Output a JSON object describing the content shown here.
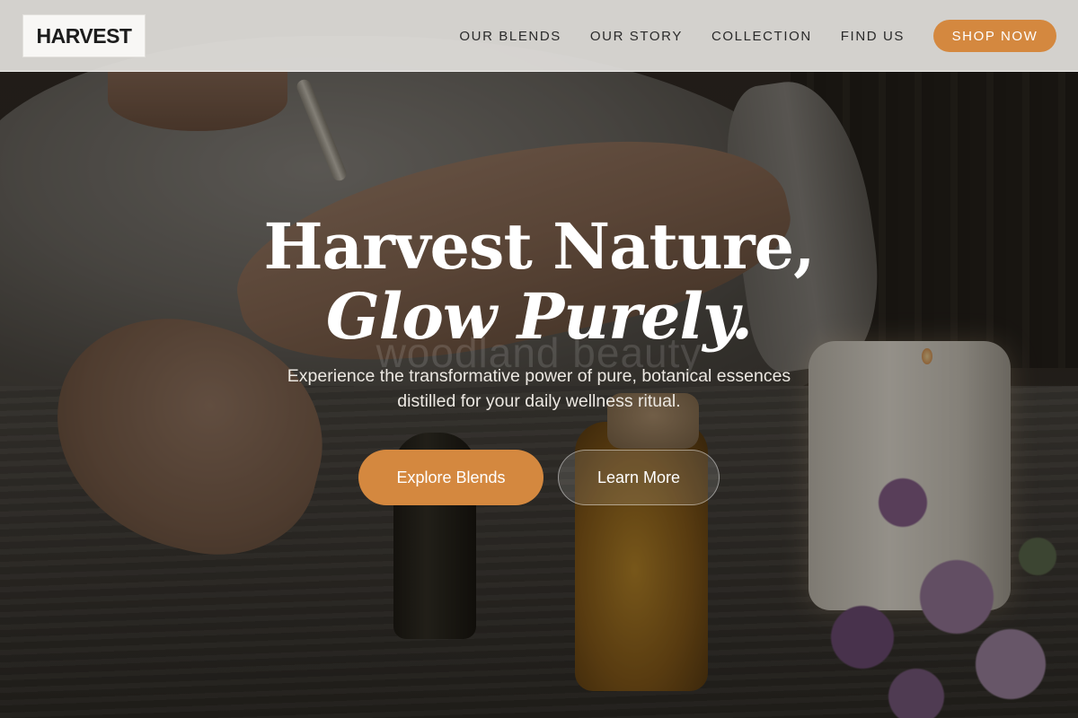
{
  "brand": {
    "name": "HARVEST"
  },
  "nav": {
    "items": [
      {
        "label": "OUR BLENDS"
      },
      {
        "label": "OUR STORY"
      },
      {
        "label": "COLLECTION"
      },
      {
        "label": "FIND US"
      }
    ],
    "cta_label": "SHOP NOW"
  },
  "hero": {
    "headline_line1": "Harvest Nature,",
    "headline_line2": "Glow Purely.",
    "watermark": "woodland beauty",
    "subtitle_line1": "Experience the transformative power of pure, botanical essences",
    "subtitle_line2": "distilled for your daily wellness ritual.",
    "primary_button": "Explore Blends",
    "secondary_button": "Learn More"
  },
  "colors": {
    "accent": "#d4883f",
    "header_bg": "#e1dfdc",
    "text_light": "#ffffff"
  }
}
